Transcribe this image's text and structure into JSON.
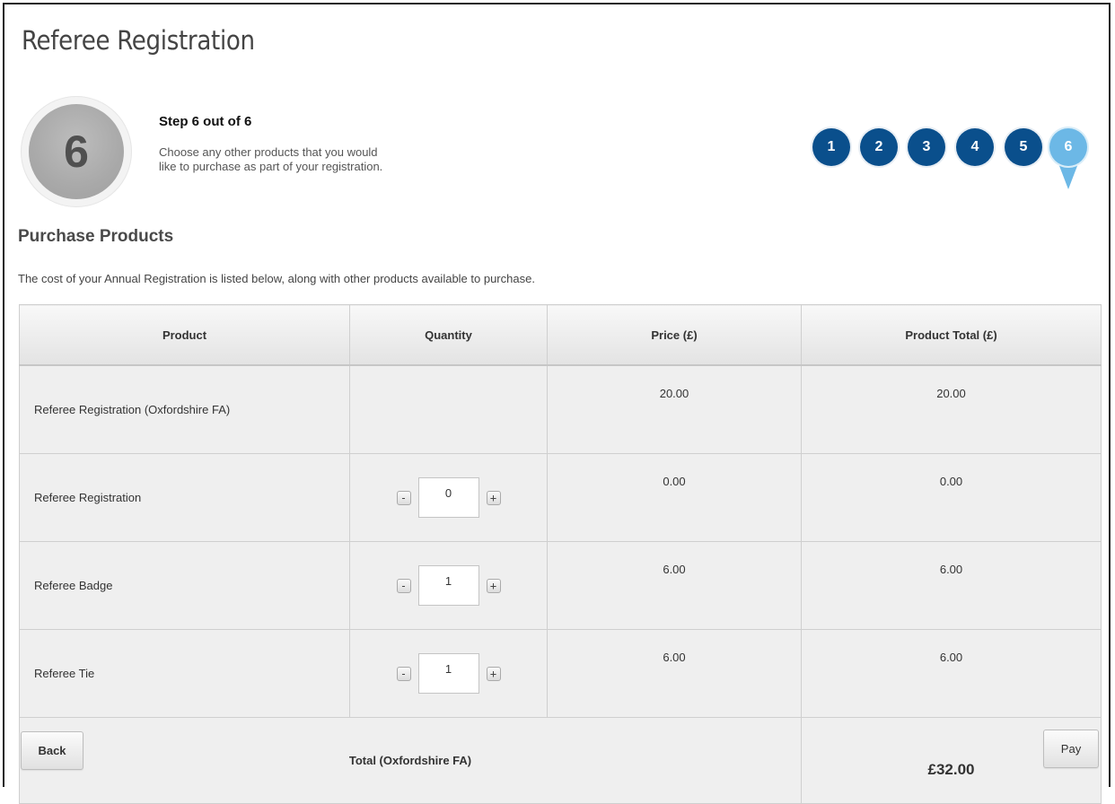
{
  "page": {
    "title": "Referee Registration"
  },
  "step": {
    "number": "6",
    "heading": "Step 6 out of 6",
    "description_line1": "Choose any other products that you would",
    "description_line2": "like to purchase as part of your registration."
  },
  "steps_nav": {
    "steps": [
      "1",
      "2",
      "3",
      "4",
      "5",
      "6"
    ],
    "current": "6"
  },
  "section": {
    "title": "Purchase Products",
    "description": "The cost of your Annual Registration is listed below, along with other products available to purchase."
  },
  "table": {
    "headers": [
      "Product",
      "Quantity",
      "Price (£)",
      "Product Total (£)"
    ],
    "rows": [
      {
        "product": "Referee Registration (Oxfordshire FA)",
        "quantity": null,
        "price": "20.00",
        "total": "20.00"
      },
      {
        "product": "Referee Registration",
        "quantity": "0",
        "price": "0.00",
        "total": "0.00"
      },
      {
        "product": "Referee Badge",
        "quantity": "1",
        "price": "6.00",
        "total": "6.00"
      },
      {
        "product": "Referee Tie",
        "quantity": "1",
        "price": "6.00",
        "total": "6.00"
      }
    ],
    "minus_label": "-",
    "plus_label": "+",
    "total_label": "Total (Oxfordshire FA)",
    "total_value": "£32.00"
  },
  "buttons": {
    "back": "Back",
    "pay": "Pay"
  },
  "colors": {
    "step_dot": "#0a4f8c",
    "step_dot_active": "#6cb8e6"
  }
}
